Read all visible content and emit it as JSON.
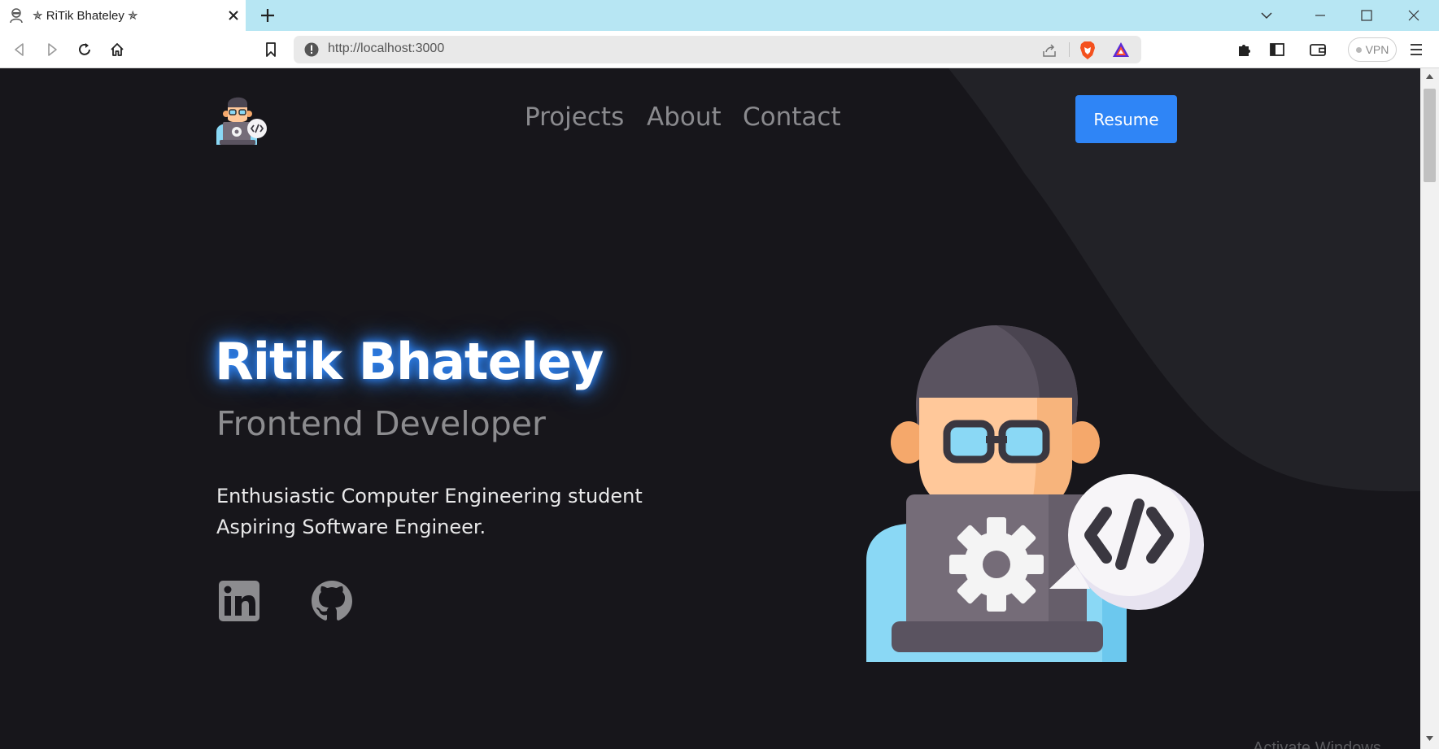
{
  "browser": {
    "tab": {
      "title": "✯ RiTik Bhateley ✯"
    },
    "url": "http://localhost:3000",
    "vpn_label": "VPN"
  },
  "nav": {
    "items": [
      "Projects",
      "About",
      "Contact"
    ],
    "resume_label": "Resume"
  },
  "hero": {
    "name": "Ritik Bhateley",
    "role": "Frontend Developer",
    "description_lines": [
      "Enthusiastic Computer Engineering student",
      "Aspiring Software Engineer."
    ]
  },
  "social": [
    "linkedin-icon",
    "github-icon"
  ],
  "watermark": "Activate Windows",
  "colors": {
    "page_bg": "#17161b",
    "accent_shape": "#222227",
    "resume_bg": "#2f85f6",
    "tabbar_bg": "#b7e6f3",
    "name_glow": "#2f85f6"
  }
}
